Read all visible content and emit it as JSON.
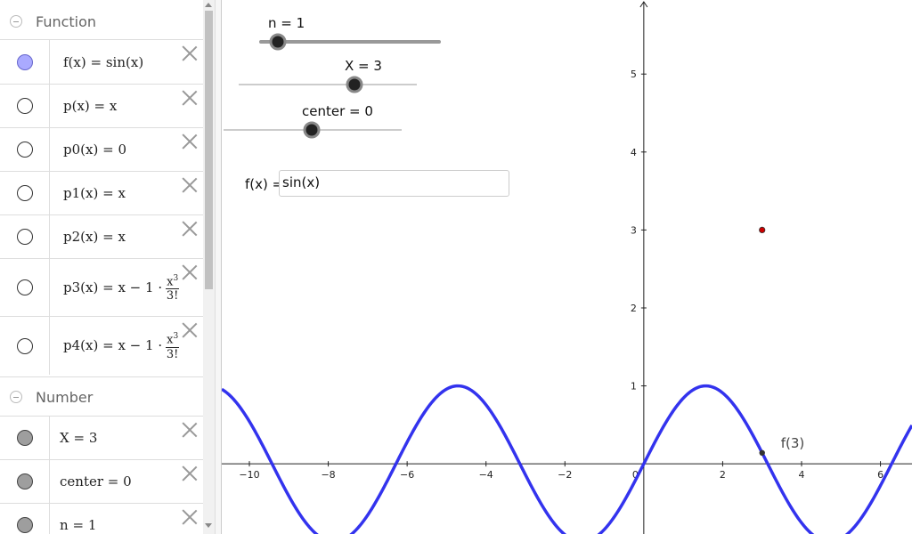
{
  "algebra": {
    "function_group": "Function",
    "number_group": "Number",
    "functions": [
      {
        "name": "f(x)",
        "expr": "sin(x)",
        "visible": true
      },
      {
        "name": "p(x)",
        "expr": "x",
        "visible": false
      },
      {
        "name": "p0(x)",
        "expr": "0",
        "visible": false
      },
      {
        "name": "p1(x)",
        "expr": "x",
        "visible": false
      },
      {
        "name": "p2(x)",
        "expr": "x",
        "visible": false
      },
      {
        "name": "p3(x)",
        "expr": "x − 1 ·",
        "frac_num": "x",
        "frac_exp": "3",
        "frac_den": "3!",
        "visible": false
      },
      {
        "name": "p4(x)",
        "expr": "x − 1 ·",
        "frac_num": "x",
        "frac_exp": "3",
        "frac_den": "3!",
        "visible": false
      }
    ],
    "numbers": [
      {
        "name": "X",
        "value": "3"
      },
      {
        "name": "center",
        "value": "0"
      },
      {
        "name": "n",
        "value": "1"
      }
    ],
    "eq": "="
  },
  "sliders": {
    "n": {
      "label": "n = 1",
      "value": 1,
      "min": 0,
      "max": 8
    },
    "X": {
      "label": "X = 3",
      "value": 3,
      "min": -10,
      "max": 10
    },
    "center": {
      "label": "center = 0",
      "value": 0,
      "min": -10,
      "max": 10
    }
  },
  "input": {
    "label": "f(x) =",
    "value": "sin(x)"
  },
  "graph": {
    "xlim": [
      -10.7,
      6.8
    ],
    "ylim": [
      -0.9,
      5.95
    ],
    "x_ticks": [
      -10,
      -8,
      -6,
      -4,
      -2,
      0,
      2,
      4,
      6
    ],
    "y_ticks": [
      1,
      2,
      3,
      4,
      5
    ],
    "curve": "sin(x)",
    "curve_color": "#3333ee",
    "point_X": {
      "x": 3,
      "y": 3,
      "color": "#cc0000"
    },
    "point_f": {
      "x": 3,
      "label": "f(3)"
    }
  }
}
